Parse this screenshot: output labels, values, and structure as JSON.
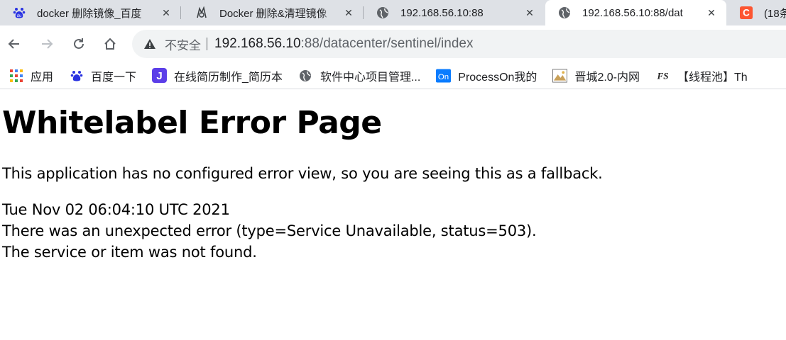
{
  "tabs": [
    {
      "title": "docker 删除镜像_百度",
      "icon": "baidu-paw-icon",
      "active": false
    },
    {
      "title": "Docker 删除&清理镜像",
      "icon": "horse-logo-icon",
      "active": false
    },
    {
      "title": "192.168.56.10:88",
      "icon": "globe-icon",
      "active": false
    },
    {
      "title": "192.168.56.10:88/dat",
      "icon": "globe-icon",
      "active": true
    },
    {
      "title": "(18条",
      "icon": "csdn-c-icon",
      "active": false
    }
  ],
  "omnibox": {
    "security_text": "不安全",
    "url_host": "192.168.56.10",
    "url_rest": ":88/datacenter/sentinel/index"
  },
  "bookmarks": [
    {
      "label": "应用",
      "icon": "apps-grid-icon"
    },
    {
      "label": "百度一下",
      "icon": "baidu-paw-icon"
    },
    {
      "label": "在线简历制作_简历本",
      "icon": "j-logo-icon"
    },
    {
      "label": "软件中心项目管理...",
      "icon": "globe-icon"
    },
    {
      "label": "ProcessOn我的",
      "icon": "processon-icon"
    },
    {
      "label": "晋城2.0-内网",
      "icon": "image-thumb-icon"
    },
    {
      "label": "【线程池】Th",
      "icon": "fs-logo-icon"
    }
  ],
  "page": {
    "heading": "Whitelabel Error Page",
    "lead": "This application has no configured error view, so you are seeing this as a fallback.",
    "timestamp": "Tue Nov 02 06:04:10 UTC 2021",
    "error_line": "There was an unexpected error (type=Service Unavailable, status=503).",
    "message": "The service or item was not found."
  },
  "colors": {
    "tabstrip_bg": "#dee1e6",
    "omnibox_bg": "#f1f3f4",
    "baidu_blue": "#2932e1",
    "csdn_red": "#fc5531"
  }
}
